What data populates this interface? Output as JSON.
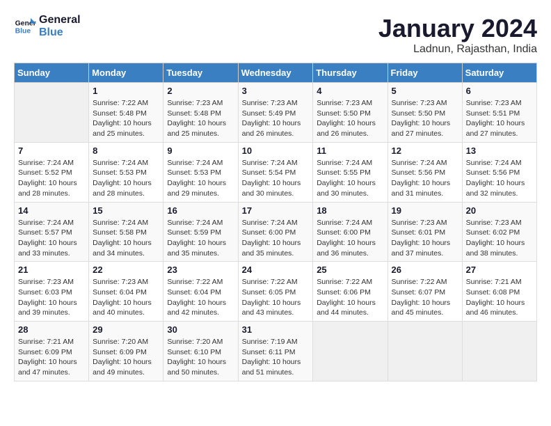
{
  "header": {
    "logo_line1": "General",
    "logo_line2": "Blue",
    "month": "January 2024",
    "location": "Ladnun, Rajasthan, India"
  },
  "days_of_week": [
    "Sunday",
    "Monday",
    "Tuesday",
    "Wednesday",
    "Thursday",
    "Friday",
    "Saturday"
  ],
  "weeks": [
    [
      {
        "num": "",
        "info": ""
      },
      {
        "num": "1",
        "info": "Sunrise: 7:22 AM\nSunset: 5:48 PM\nDaylight: 10 hours\nand 25 minutes."
      },
      {
        "num": "2",
        "info": "Sunrise: 7:23 AM\nSunset: 5:48 PM\nDaylight: 10 hours\nand 25 minutes."
      },
      {
        "num": "3",
        "info": "Sunrise: 7:23 AM\nSunset: 5:49 PM\nDaylight: 10 hours\nand 26 minutes."
      },
      {
        "num": "4",
        "info": "Sunrise: 7:23 AM\nSunset: 5:50 PM\nDaylight: 10 hours\nand 26 minutes."
      },
      {
        "num": "5",
        "info": "Sunrise: 7:23 AM\nSunset: 5:50 PM\nDaylight: 10 hours\nand 27 minutes."
      },
      {
        "num": "6",
        "info": "Sunrise: 7:23 AM\nSunset: 5:51 PM\nDaylight: 10 hours\nand 27 minutes."
      }
    ],
    [
      {
        "num": "7",
        "info": "Sunrise: 7:24 AM\nSunset: 5:52 PM\nDaylight: 10 hours\nand 28 minutes."
      },
      {
        "num": "8",
        "info": "Sunrise: 7:24 AM\nSunset: 5:53 PM\nDaylight: 10 hours\nand 28 minutes."
      },
      {
        "num": "9",
        "info": "Sunrise: 7:24 AM\nSunset: 5:53 PM\nDaylight: 10 hours\nand 29 minutes."
      },
      {
        "num": "10",
        "info": "Sunrise: 7:24 AM\nSunset: 5:54 PM\nDaylight: 10 hours\nand 30 minutes."
      },
      {
        "num": "11",
        "info": "Sunrise: 7:24 AM\nSunset: 5:55 PM\nDaylight: 10 hours\nand 30 minutes."
      },
      {
        "num": "12",
        "info": "Sunrise: 7:24 AM\nSunset: 5:56 PM\nDaylight: 10 hours\nand 31 minutes."
      },
      {
        "num": "13",
        "info": "Sunrise: 7:24 AM\nSunset: 5:56 PM\nDaylight: 10 hours\nand 32 minutes."
      }
    ],
    [
      {
        "num": "14",
        "info": "Sunrise: 7:24 AM\nSunset: 5:57 PM\nDaylight: 10 hours\nand 33 minutes."
      },
      {
        "num": "15",
        "info": "Sunrise: 7:24 AM\nSunset: 5:58 PM\nDaylight: 10 hours\nand 34 minutes."
      },
      {
        "num": "16",
        "info": "Sunrise: 7:24 AM\nSunset: 5:59 PM\nDaylight: 10 hours\nand 35 minutes."
      },
      {
        "num": "17",
        "info": "Sunrise: 7:24 AM\nSunset: 6:00 PM\nDaylight: 10 hours\nand 35 minutes."
      },
      {
        "num": "18",
        "info": "Sunrise: 7:24 AM\nSunset: 6:00 PM\nDaylight: 10 hours\nand 36 minutes."
      },
      {
        "num": "19",
        "info": "Sunrise: 7:23 AM\nSunset: 6:01 PM\nDaylight: 10 hours\nand 37 minutes."
      },
      {
        "num": "20",
        "info": "Sunrise: 7:23 AM\nSunset: 6:02 PM\nDaylight: 10 hours\nand 38 minutes."
      }
    ],
    [
      {
        "num": "21",
        "info": "Sunrise: 7:23 AM\nSunset: 6:03 PM\nDaylight: 10 hours\nand 39 minutes."
      },
      {
        "num": "22",
        "info": "Sunrise: 7:23 AM\nSunset: 6:04 PM\nDaylight: 10 hours\nand 40 minutes."
      },
      {
        "num": "23",
        "info": "Sunrise: 7:22 AM\nSunset: 6:04 PM\nDaylight: 10 hours\nand 42 minutes."
      },
      {
        "num": "24",
        "info": "Sunrise: 7:22 AM\nSunset: 6:05 PM\nDaylight: 10 hours\nand 43 minutes."
      },
      {
        "num": "25",
        "info": "Sunrise: 7:22 AM\nSunset: 6:06 PM\nDaylight: 10 hours\nand 44 minutes."
      },
      {
        "num": "26",
        "info": "Sunrise: 7:22 AM\nSunset: 6:07 PM\nDaylight: 10 hours\nand 45 minutes."
      },
      {
        "num": "27",
        "info": "Sunrise: 7:21 AM\nSunset: 6:08 PM\nDaylight: 10 hours\nand 46 minutes."
      }
    ],
    [
      {
        "num": "28",
        "info": "Sunrise: 7:21 AM\nSunset: 6:09 PM\nDaylight: 10 hours\nand 47 minutes."
      },
      {
        "num": "29",
        "info": "Sunrise: 7:20 AM\nSunset: 6:09 PM\nDaylight: 10 hours\nand 49 minutes."
      },
      {
        "num": "30",
        "info": "Sunrise: 7:20 AM\nSunset: 6:10 PM\nDaylight: 10 hours\nand 50 minutes."
      },
      {
        "num": "31",
        "info": "Sunrise: 7:19 AM\nSunset: 6:11 PM\nDaylight: 10 hours\nand 51 minutes."
      },
      {
        "num": "",
        "info": ""
      },
      {
        "num": "",
        "info": ""
      },
      {
        "num": "",
        "info": ""
      }
    ]
  ]
}
